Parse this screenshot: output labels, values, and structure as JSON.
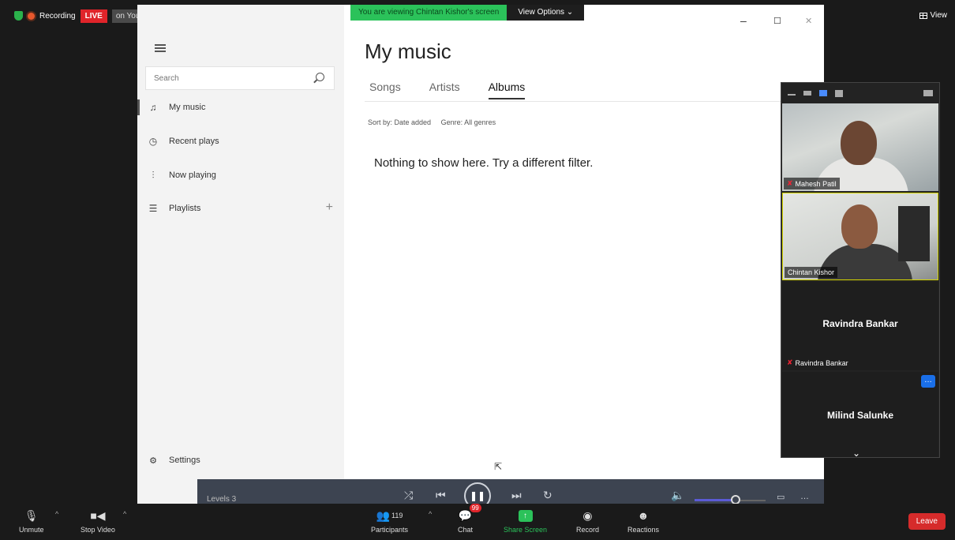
{
  "topbar": {
    "recording_label": "Recording",
    "live_label": "LIVE",
    "on_youtube_label": "on YouTube",
    "view_label": "View"
  },
  "share_banner": {
    "viewing_text": "You are viewing Chintan Kishor's screen",
    "view_options_label": "View Options"
  },
  "window_controls": {
    "minimize": "–",
    "maximize": "☐",
    "close": "✕"
  },
  "sidebar": {
    "search_placeholder": "Search",
    "items": [
      {
        "label": "My music",
        "icon": "♫"
      },
      {
        "label": "Recent plays",
        "icon": "◷"
      },
      {
        "label": "Now playing",
        "icon": "⫶"
      },
      {
        "label": "Playlists",
        "icon": "☰"
      }
    ],
    "settings_label": "Settings"
  },
  "main": {
    "title": "My music",
    "tabs": [
      {
        "label": "Songs"
      },
      {
        "label": "Artists"
      },
      {
        "label": "Albums"
      }
    ],
    "sort_by": "Sort by: Date added",
    "genre": "Genre: All genres",
    "empty_message": "Nothing to show here. Try a different filter."
  },
  "player": {
    "now_playing": "Levels 3"
  },
  "gallery": {
    "participants": [
      {
        "name": "Mahesh Patil"
      },
      {
        "name": "Chintan Kishor"
      },
      {
        "name": "Ravindra Bankar"
      },
      {
        "name": "Milind Salunke"
      }
    ]
  },
  "toolbar": {
    "unmute": "Unmute",
    "stop_video": "Stop Video",
    "participants": "Participants",
    "participants_count": "119",
    "chat": "Chat",
    "chat_badge": "99",
    "share_screen": "Share Screen",
    "record": "Record",
    "reactions": "Reactions",
    "leave": "Leave"
  },
  "colors": {
    "live_red": "#e0242a",
    "share_green": "#2bc25a",
    "leave_red": "#d62b2b",
    "accent_blue": "#1a6fe8"
  }
}
